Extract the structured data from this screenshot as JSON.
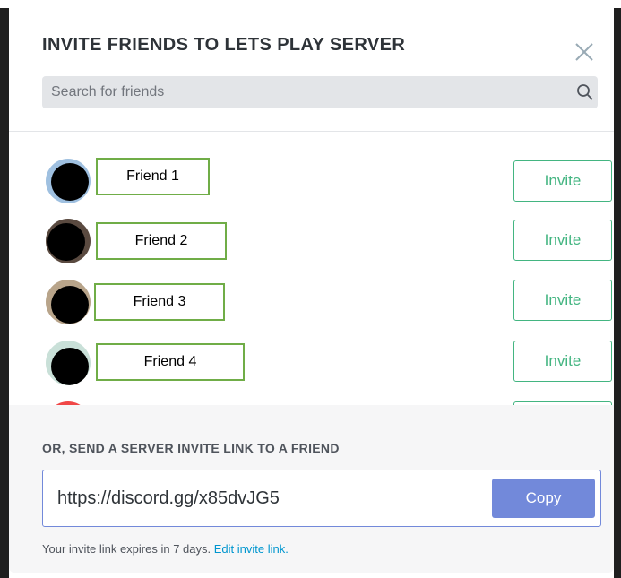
{
  "modal": {
    "title": "INVITE FRIENDS TO LETS PLAY SERVER",
    "search_placeholder": "Search for friends"
  },
  "friends": [
    {
      "name": "Friend 1",
      "invite_label": "Invite"
    },
    {
      "name": "Friend 2",
      "invite_label": "Invite"
    },
    {
      "name": "Friend 3",
      "invite_label": "Invite"
    },
    {
      "name": "Friend 4",
      "invite_label": "Invite"
    }
  ],
  "invite_link": {
    "heading": "OR, SEND A SERVER INVITE LINK TO A FRIEND",
    "url": "https://discord.gg/x85dvJG5",
    "copy_label": "Copy",
    "expire_text": "Your invite link expires in 7 days.",
    "edit_link": "Edit invite link."
  },
  "colors": {
    "invite_green": "#43b581",
    "copy_blurple": "#7289da",
    "highlight_box": "#70ad47",
    "link_blue": "#0096cf"
  }
}
